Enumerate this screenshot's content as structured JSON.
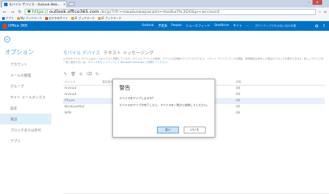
{
  "browser": {
    "tab_title": "モバイル デバイス - Outlook Web...",
    "tab_close": "×",
    "url_scheme": "https://",
    "url_host": "outlook.office365.com",
    "url_path": "/ecp/?rfr=owa&owaparam=modurl%3D0&p=account",
    "back": "←",
    "forward": "→",
    "reload": "↻",
    "bookmarks": [
      {
        "label": "アプリ",
        "icon": "apps-icon"
      },
      {
        "label": "My ブックマーク",
        "icon": "bookmark-icon"
      },
      {
        "label": "おすすめサイト",
        "icon": "bookmark-icon"
      },
      {
        "label": "IE ブックマーク",
        "icon": "folder-icon"
      },
      {
        "label": "IE ブックマーク",
        "icon": "folder-icon"
      }
    ]
  },
  "o365": {
    "brand": "Office 365",
    "nav": [
      "Outlook",
      "予定表",
      "People",
      "ニュースフィード",
      "OneDrive",
      "サイト",
      "…"
    ],
    "search_placeholder": "がワンアップされる払い出の本番"
  },
  "left_nav": {
    "title": "オプション",
    "items": [
      "アカウント",
      "メールの整理",
      "グループ",
      "サイト メールボックス",
      "設定",
      "電話",
      "ブロックまたは許可",
      "アプリ"
    ],
    "active_index": 5
  },
  "main": {
    "title": "モバイル デバイス",
    "subtitle": "テキスト メッセージング",
    "description": "以下のモバイル デバイスはメールボックスと同期しています。モバイル デバイスの削除、デバイスの詳細のワイプへのアクセス、リモート デバイス ワイプの開始、携帯電話を紛失した場合のブロックを実行できます。新しいデバイスを一覧に追加するには、",
    "description_link": "デバイスをセットアップして Microsoft Exchange と同期してください。",
    "table": {
      "headers": [
        "デバイス",
        "電話番号",
        "状態"
      ],
      "rows": [
        {
          "device": "Android",
          "status": "OK"
        },
        {
          "device": "Android",
          "status": "OK"
        },
        {
          "device": "iPhone",
          "status": "OK"
        },
        {
          "device": "WindowsMail",
          "status": "OK"
        },
        {
          "device": "WP8",
          "status": "OK"
        }
      ],
      "selected_index": 2
    }
  },
  "dialog": {
    "title": "警告",
    "question": "デバイスをワイプしますか?",
    "message": "デバイスのワイプが完了したら、アバイスを一覧から削除してください。",
    "yes": "はい",
    "no": "いいえ"
  }
}
